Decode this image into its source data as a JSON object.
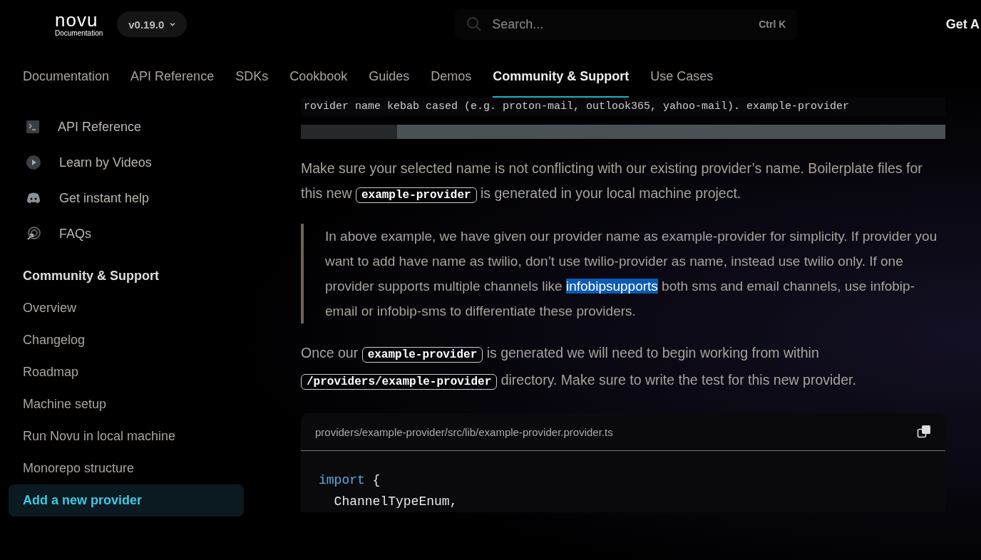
{
  "header": {
    "logo": "novu",
    "logo_subtitle": "Documentation",
    "version": "v0.19.0",
    "search": {
      "placeholder": "Search...",
      "shortcut": "Ctrl K"
    },
    "cta": "Get A"
  },
  "nav_tabs": [
    {
      "label": "Documentation",
      "selected": false
    },
    {
      "label": "API Reference",
      "selected": false
    },
    {
      "label": "SDKs",
      "selected": false
    },
    {
      "label": "Cookbook",
      "selected": false
    },
    {
      "label": "Guides",
      "selected": false
    },
    {
      "label": "Demos",
      "selected": false
    },
    {
      "label": "Community & Support",
      "selected": true
    },
    {
      "label": "Use Cases",
      "selected": false
    }
  ],
  "sidebar": {
    "links": [
      {
        "label": "API Reference"
      },
      {
        "label": "Learn by Videos"
      },
      {
        "label": "Get instant help"
      },
      {
        "label": "FAQs"
      }
    ],
    "section_title": "Community & Support",
    "items": [
      {
        "label": "Overview",
        "selected": false
      },
      {
        "label": "Changelog",
        "selected": false
      },
      {
        "label": "Roadmap",
        "selected": false
      },
      {
        "label": "Machine setup",
        "selected": false
      },
      {
        "label": "Run Novu in local machine",
        "selected": false
      },
      {
        "label": "Monorepo structure",
        "selected": false
      },
      {
        "label": "Add a new provider",
        "selected": true
      }
    ]
  },
  "content": {
    "top_code_line": "rovider name kebab cased  (e.g. proton-mail, outlook365, yahoo-mail). example-provider",
    "paragraphs": [
      {
        "kind": "text",
        "parts": [
          {
            "kind": "text",
            "text": "Make sure your selected name is not conflicting with our existing provider’s name. Boilerplate files for this new "
          },
          {
            "kind": "code",
            "text": "example-provider"
          },
          {
            "kind": "text",
            "text": " is generated in your local machine project."
          }
        ]
      },
      {
        "kind": "quote",
        "parts": [
          {
            "kind": "text",
            "text": "In above example, we have given our provider name as example-provider for simplicity. If provider you want to add have name as twilio, don’t use twilio-provider as name, instead use twilio only. If one provider supports multiple channels like "
          },
          {
            "kind": "highlight",
            "text": "infobipsupports"
          },
          {
            "kind": "text",
            "text": " both sms and email channels, use infobip-email or infobip-sms to differentiate these providers."
          }
        ]
      },
      {
        "kind": "text",
        "parts": [
          {
            "kind": "text",
            "text": "Once our "
          },
          {
            "kind": "code",
            "text": "example-provider"
          },
          {
            "kind": "text",
            "text": " is generated we will need to begin working from within "
          },
          {
            "kind": "code",
            "text": "/providers/example-provider"
          },
          {
            "kind": "text",
            "text": " directory. Make sure to write the test for this new provider."
          }
        ]
      }
    ],
    "code_block": {
      "filename": "providers/example-provider/src/lib/example-provider.provider.ts",
      "lines": [
        [
          {
            "kind": "keyword",
            "text": "import"
          },
          {
            "kind": "plain",
            "text": " {"
          }
        ],
        [
          {
            "kind": "plain",
            "text": "  ChannelTypeEnum,"
          }
        ]
      ]
    }
  }
}
